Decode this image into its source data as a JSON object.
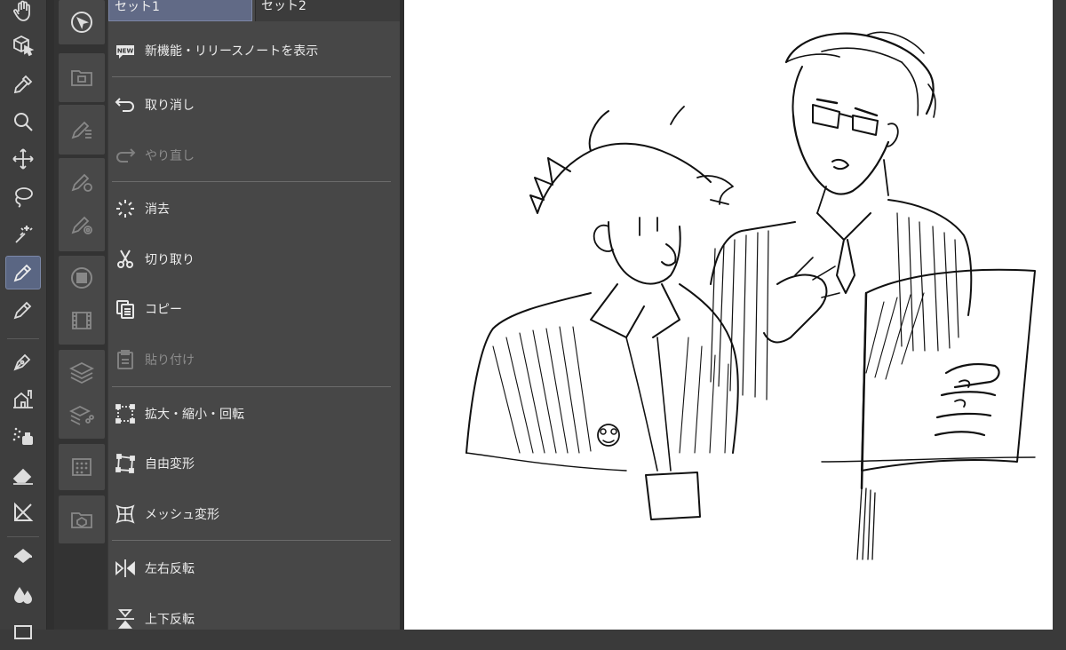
{
  "command_bar": {
    "tabs": [
      {
        "label": "セット1",
        "selected": true
      },
      {
        "label": "セット2",
        "selected": false
      }
    ],
    "new_badge": "NEW",
    "items": [
      {
        "id": "release-notes",
        "label": "新機能・リリースノートを表示",
        "icon": "new-badge-icon",
        "enabled": true
      },
      {
        "id": "undo",
        "label": "取り消し",
        "icon": "undo-icon",
        "enabled": true
      },
      {
        "id": "redo",
        "label": "やり直し",
        "icon": "redo-icon",
        "enabled": false
      },
      {
        "id": "clear",
        "label": "消去",
        "icon": "clear-icon",
        "enabled": true
      },
      {
        "id": "cut",
        "label": "切り取り",
        "icon": "scissors-icon",
        "enabled": true
      },
      {
        "id": "copy",
        "label": "コピー",
        "icon": "copy-icon",
        "enabled": true
      },
      {
        "id": "paste",
        "label": "貼り付け",
        "icon": "paste-icon",
        "enabled": false
      },
      {
        "id": "scale-rotate",
        "label": "拡大・縮小・回転",
        "icon": "transform-icon",
        "enabled": true
      },
      {
        "id": "free-transform",
        "label": "自由変形",
        "icon": "free-transform-icon",
        "enabled": true
      },
      {
        "id": "mesh-transform",
        "label": "メッシュ変形",
        "icon": "mesh-transform-icon",
        "enabled": true
      },
      {
        "id": "flip-h",
        "label": "左右反転",
        "icon": "flip-horizontal-icon",
        "enabled": true
      },
      {
        "id": "flip-v",
        "label": "上下反転",
        "icon": "flip-vertical-icon",
        "enabled": true
      }
    ]
  },
  "toolbar": {
    "tools": [
      {
        "id": "hand",
        "icon": "hand-icon",
        "active": false
      },
      {
        "id": "operation",
        "icon": "object-select-icon",
        "active": false
      },
      {
        "id": "eyedropper",
        "icon": "eyedropper-icon",
        "active": false
      },
      {
        "id": "zoom",
        "icon": "magnifier-icon",
        "active": false
      },
      {
        "id": "move",
        "icon": "move-arrows-icon",
        "active": false
      },
      {
        "id": "lasso",
        "icon": "lasso-icon",
        "active": false
      },
      {
        "id": "auto-select",
        "icon": "magic-wand-icon",
        "active": false
      },
      {
        "id": "pen",
        "icon": "pen-icon",
        "active": true
      },
      {
        "id": "pencil",
        "icon": "pencil-icon",
        "active": false
      },
      {
        "id": "ink-pen",
        "icon": "fountain-pen-icon",
        "active": false
      },
      {
        "id": "decoration",
        "icon": "decoration-icon",
        "active": false
      },
      {
        "id": "airbrush",
        "icon": "airbrush-icon",
        "active": false
      },
      {
        "id": "eraser",
        "icon": "eraser-icon",
        "active": false
      },
      {
        "id": "ruler",
        "icon": "ruler-icon",
        "active": false
      },
      {
        "id": "fill",
        "icon": "paint-bucket-icon",
        "active": false
      },
      {
        "id": "blend",
        "icon": "blend-drops-icon",
        "active": false
      }
    ]
  },
  "sub_toolbar": {
    "icons": [
      "quick-access-icon",
      "material-folder-icon",
      "sub-tool-detail-icon",
      "tool-property-icon",
      "brush-size-icon",
      "color-circle-icon",
      "animation-timeline-icon",
      "layer-icon",
      "layer-property-icon",
      "navigator-icon",
      "item-bank-icon"
    ]
  },
  "colors": {
    "accent_selected": "#616a86",
    "panel_bg": "#474747",
    "canvas_bg": "#ffffff"
  }
}
